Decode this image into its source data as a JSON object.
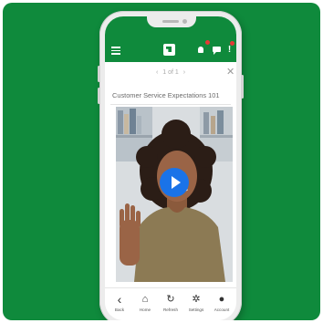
{
  "app": {
    "brand_color": "#0f8a3c",
    "accent_color": "#1a73e8",
    "badge_color": "#e53935"
  },
  "header": {
    "icons": [
      "menu-icon",
      "logo-icon",
      "bell-icon",
      "chat-icon",
      "alert-icon"
    ],
    "alert_glyph": "!"
  },
  "pager": {
    "prev": "‹",
    "text": "1 of 1",
    "next": "›",
    "close_glyph": "✕"
  },
  "lesson": {
    "title": "Customer Service Expectations 101"
  },
  "video": {
    "state": "paused",
    "play_icon": "play-icon"
  },
  "bottom_nav": {
    "items": [
      {
        "label": "Back",
        "icon": "chevron-left-icon",
        "glyph": "‹"
      },
      {
        "label": "Home",
        "icon": "home-icon",
        "glyph": "⌂"
      },
      {
        "label": "Refresh",
        "icon": "refresh-icon",
        "glyph": "↻"
      },
      {
        "label": "Settings",
        "icon": "gear-icon",
        "glyph": "✲"
      },
      {
        "label": "Account",
        "icon": "person-icon",
        "glyph": "●"
      }
    ]
  }
}
